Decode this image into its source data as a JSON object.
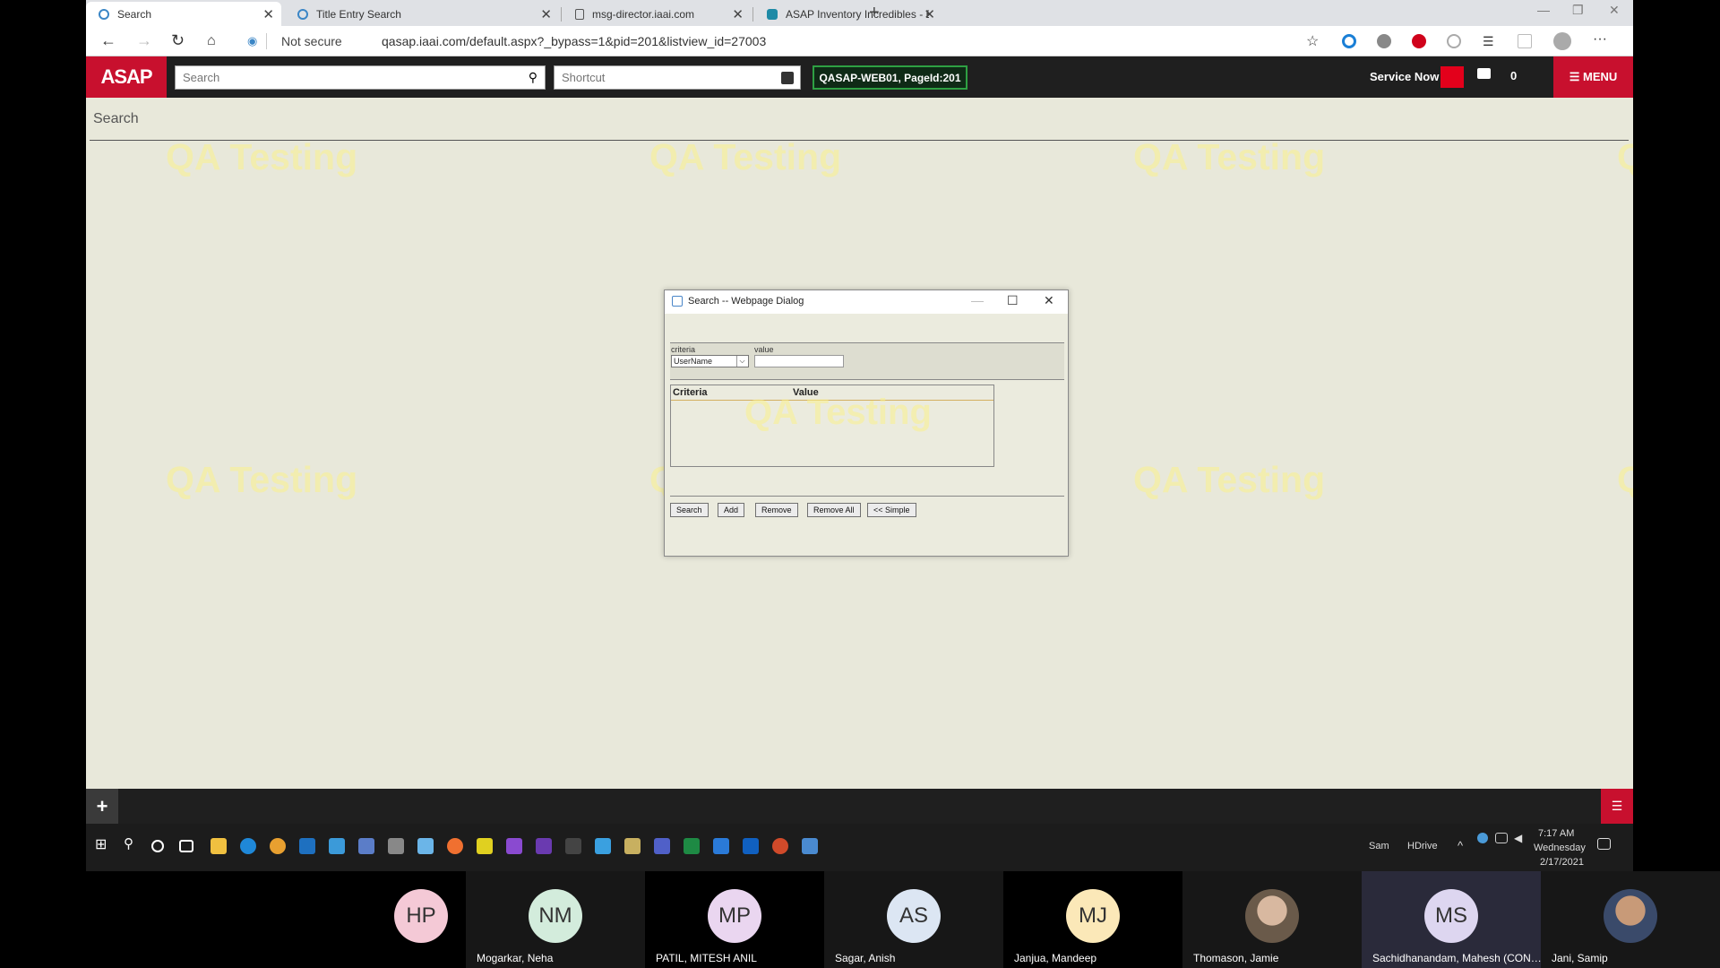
{
  "browser": {
    "tabs": [
      {
        "title": "Search"
      },
      {
        "title": "Title Entry Search"
      },
      {
        "title": "msg-director.iaai.com"
      },
      {
        "title": "ASAP Inventory Incredibles - EAI"
      }
    ],
    "new_tab": "+",
    "not_secure": "Not secure",
    "url": "qasap.iaai.com/default.aspx?_bypass=1&pid=201&listview_id=27003"
  },
  "app": {
    "logo": "ASAP",
    "search_placeholder": "Search",
    "shortcut_placeholder": "Shortcut",
    "server_badge": "QASAP-WEB01, PageId:201",
    "service_now": "Service Now",
    "notification_count": "0",
    "menu_label": "☰ MENU",
    "page_title": "Search",
    "watermark": "QA Testing"
  },
  "dialog": {
    "title": "Search -- Webpage Dialog",
    "criteria_label": "criteria",
    "value_label": "value",
    "criteria_selected": "UserName",
    "value_current": "",
    "table_headers": [
      "Criteria",
      "Value"
    ],
    "buttons": {
      "search": "Search",
      "add": "Add",
      "remove": "Remove",
      "remove_all": "Remove All",
      "simple": "<< Simple"
    }
  },
  "footer": {
    "plus": "+",
    "list_icon": "list-icon"
  },
  "taskbar": {
    "user1": "Sam",
    "user2": "HDrive",
    "time": "7:17 AM",
    "day": "Wednesday",
    "date": "2/17/2021"
  },
  "participants": [
    {
      "initials": "HP",
      "name": "",
      "color": "#f4c9d6"
    },
    {
      "initials": "NM",
      "name": "Mogarkar, Neha",
      "color": "#d3ecdc"
    },
    {
      "initials": "MP",
      "name": "PATIL, MITESH ANIL",
      "color": "#ead6f0"
    },
    {
      "initials": "AS",
      "name": "Sagar, Anish",
      "color": "#dce6f3"
    },
    {
      "initials": "MJ",
      "name": "Janjua, Mandeep",
      "color": "#fbe8b8"
    },
    {
      "initials": "",
      "name": "Thomason, Jamie",
      "color": "#8a7a6a"
    },
    {
      "initials": "MS",
      "name": "Sachidhanandam, Mahesh (CONTR...",
      "color": "#ddd6f0"
    },
    {
      "initials": "",
      "name": "Jani, Samip",
      "color": "#6a5a4a"
    }
  ]
}
